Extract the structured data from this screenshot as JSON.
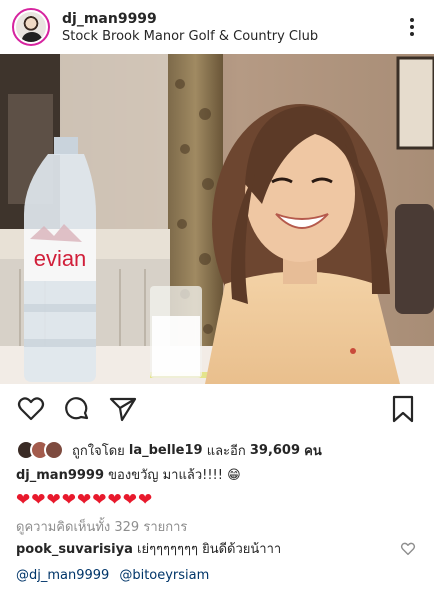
{
  "post": {
    "username": "dj_man9999",
    "location": "Stock Brook Manor Golf & Country Club"
  },
  "photo": {
    "bottle_brand": "evian"
  },
  "icons": {
    "more": "more-options-icon",
    "like": "heart-icon",
    "comment": "comment-icon",
    "share": "send-icon",
    "save": "bookmark-icon"
  },
  "likes": {
    "prefix": "ถูกใจโดย",
    "liker": "la_belle19",
    "connector": "และอีก",
    "count": "39,609",
    "suffix": "คน"
  },
  "caption": {
    "username": "dj_man9999",
    "text": "ของขวัญ มาแล้ว!!!! 😁",
    "hearts": "❤❤❤❤❤❤❤❤❤"
  },
  "comments": {
    "view_all": "ดูความคิดเห็นทั้ง 329 รายการ",
    "items": [
      {
        "username": "pook_suvarisiya",
        "text": "เย่ๆๆๆๆๆๆๆ ยินดีด้วยน้าาา",
        "mentions": [
          "@dj_man9999",
          "@bitoeyrsiam"
        ]
      }
    ]
  },
  "colors": {
    "text": "#262626",
    "muted": "#8e8e8e",
    "mention": "#003569",
    "heart": "#e8192c"
  }
}
